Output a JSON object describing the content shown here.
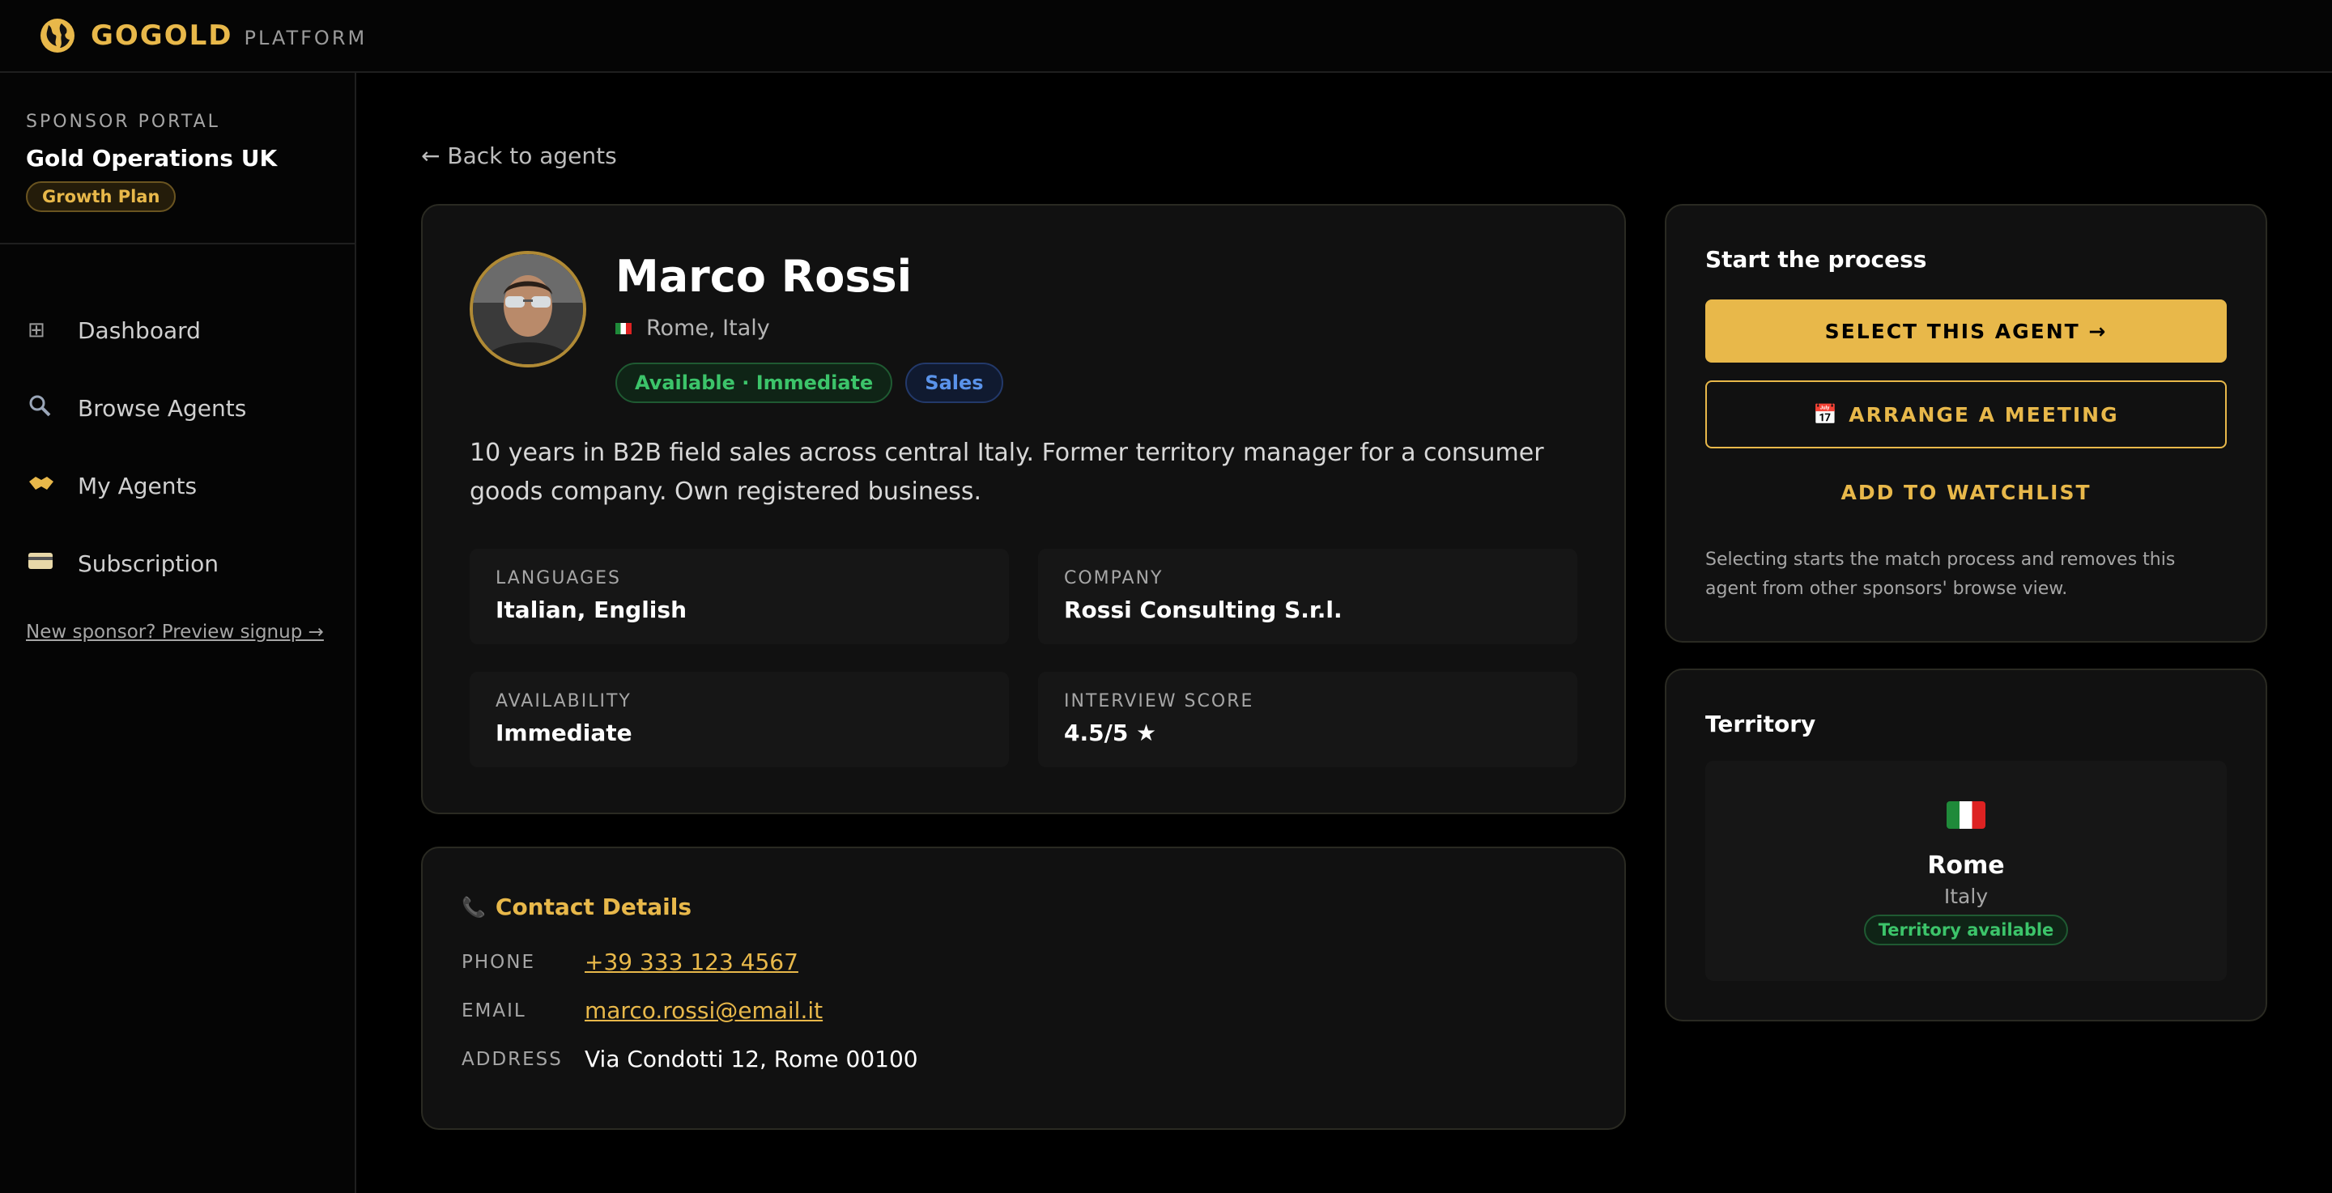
{
  "topbar": {
    "brand": "GOGOLD",
    "sub": "PLATFORM"
  },
  "sidebar": {
    "portal_label": "SPONSOR PORTAL",
    "org_name": "Gold Operations UK",
    "plan": "Growth Plan",
    "items": [
      {
        "label": "Dashboard",
        "icon": "grid-icon"
      },
      {
        "label": "Browse Agents",
        "icon": "magnifier-icon"
      },
      {
        "label": "My Agents",
        "icon": "handshake-icon"
      },
      {
        "label": "Subscription",
        "icon": "credit-card-icon"
      }
    ],
    "signup_link": "New sponsor? Preview signup →"
  },
  "main": {
    "back_link": "← Back to agents",
    "profile": {
      "name": "Marco Rossi",
      "location": "Rome, Italy",
      "badges": [
        "Available · Immediate",
        "Sales"
      ],
      "bio": "10 years in B2B field sales across central Italy. Former territory manager for a consumer goods company. Own registered business.",
      "info": [
        {
          "label": "LANGUAGES",
          "value": "Italian, English"
        },
        {
          "label": "COMPANY",
          "value": "Rossi Consulting S.r.l."
        },
        {
          "label": "AVAILABILITY",
          "value": "Immediate"
        },
        {
          "label": "INTERVIEW SCORE",
          "value": "4.5/5 ★"
        }
      ]
    },
    "contact": {
      "title": "Contact Details",
      "phone_label": "PHONE",
      "phone": "+39 333 123 4567",
      "email_label": "EMAIL",
      "email": "marco.rossi@email.it",
      "address_label": "ADDRESS",
      "address": "Via Condotti 12, Rome 00100"
    },
    "process": {
      "title": "Start the process",
      "select_label": "SELECT THIS AGENT →",
      "meeting_label": "ARRANGE A MEETING",
      "watchlist_label": "ADD TO WATCHLIST",
      "note": "Selecting starts the match process and removes this agent from other sponsors' browse view."
    },
    "territory": {
      "title": "Territory",
      "city": "Rome",
      "country": "Italy",
      "status": "Territory available"
    }
  },
  "colors": {
    "accent": "#e8b84a",
    "success": "#3cc46a",
    "info": "#5a93ea",
    "background": "#000000"
  }
}
